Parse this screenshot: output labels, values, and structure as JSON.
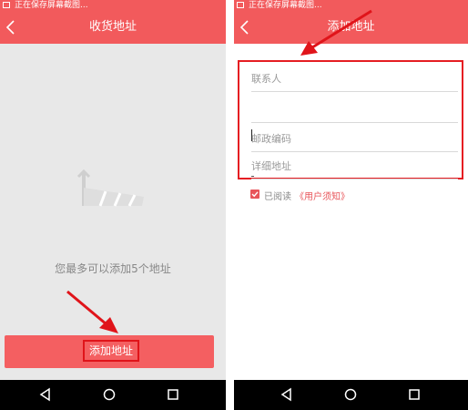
{
  "left_screen": {
    "status_text": "正在保存屏幕截图...",
    "title": "收货地址",
    "empty_hint": "您最多可以添加5个地址",
    "add_button_label": "添加地址"
  },
  "right_screen": {
    "status_text": "正在保存屏幕截图...",
    "title": "添加地址",
    "fields": {
      "contact_placeholder": "联系人",
      "phone_placeholder": "",
      "postcode_placeholder": "邮政编码",
      "detail_placeholder": "详细地址"
    },
    "agreement": {
      "checked": true,
      "read_text": "已阅读",
      "link_text": "《用户须知》"
    }
  },
  "colors": {
    "brand": "#f25a5c",
    "annotation": "#e0141a",
    "nav_bar": "#000000"
  },
  "icons": [
    "back-icon",
    "nav-back-icon",
    "nav-home-icon",
    "nav-recents-icon",
    "checkbox-icon"
  ]
}
